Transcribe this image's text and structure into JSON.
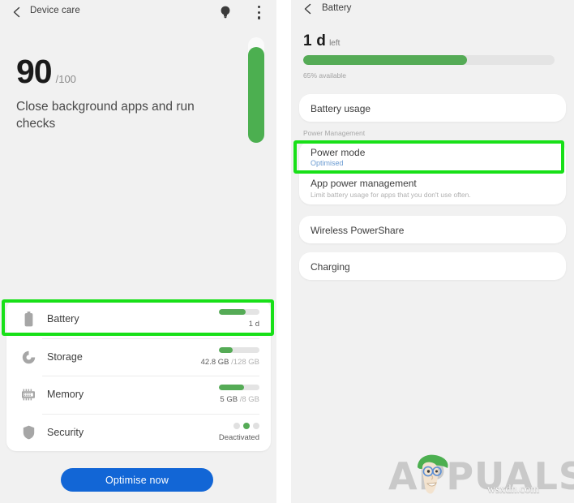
{
  "left_panel": {
    "appbar": {
      "title": "Device care",
      "back_icon": "back-chevron-icon",
      "tips_icon": "lightbulb-icon",
      "more_icon": "more-vertical-icon"
    },
    "score": {
      "value": "90",
      "denominator": "/100",
      "message": "Close background apps and run checks",
      "gauge_percent": 90
    },
    "items": [
      {
        "label": "Battery",
        "icon": "battery-icon",
        "meter_percent": 65,
        "value": "1 d",
        "value_sub": "",
        "meter_type": "bar",
        "highlighted": true
      },
      {
        "label": "Storage",
        "icon": "storage-pie-icon",
        "meter_percent": 33,
        "value": "42.8 GB",
        "value_sub": "/128 GB",
        "meter_type": "bar",
        "highlighted": false
      },
      {
        "label": "Memory",
        "icon": "memory-chip-icon",
        "meter_percent": 62,
        "value": "5 GB",
        "value_sub": "/8 GB",
        "meter_type": "bar",
        "highlighted": false
      },
      {
        "label": "Security",
        "icon": "shield-icon",
        "meter_percent": 0,
        "value": "Deactivated",
        "value_sub": "",
        "meter_type": "dots",
        "dots_active_index": 1,
        "highlighted": false
      }
    ],
    "optimise_button": "Optimise now"
  },
  "right_panel": {
    "appbar": {
      "title": "Battery",
      "back_icon": "back-chevron-icon"
    },
    "remaining": {
      "amount": "1 d",
      "unit": "left",
      "bar_percent": 65,
      "caption": "65% available"
    },
    "battery_usage": {
      "label": "Battery usage"
    },
    "section_label": "Power Management",
    "power_mode": {
      "label": "Power mode",
      "status": "Optimised",
      "highlighted": true
    },
    "app_power_management": {
      "label": "App power management",
      "description": "Limit battery usage for apps that you don't use often."
    },
    "wireless_powershare": {
      "label": "Wireless PowerShare"
    },
    "charging": {
      "label": "Charging"
    }
  },
  "watermark": {
    "brand": "APPUALS",
    "domain": "wsxdn.com"
  },
  "colors": {
    "green_accent": "#55ab56",
    "highlight_green": "#18e018",
    "blue_button": "#1266d6",
    "panel_background": "#f1f1f1",
    "card_background": "#ffffff",
    "status_blue": "#6b9bd2"
  }
}
